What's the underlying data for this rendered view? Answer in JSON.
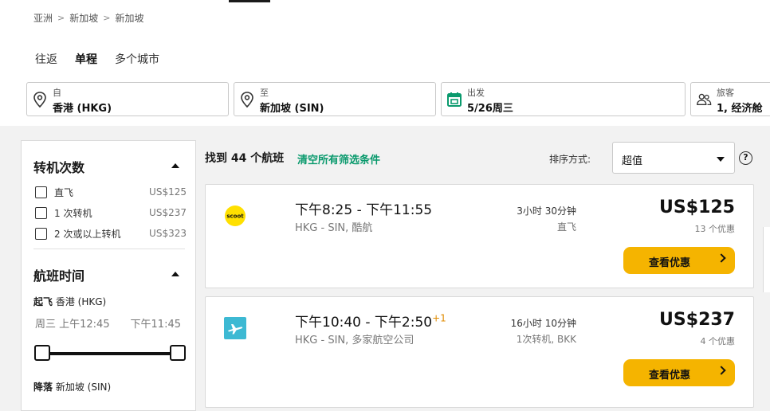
{
  "breadcrumb": [
    "亚洲",
    "新加坡",
    "新加坡"
  ],
  "trip_tabs": [
    {
      "label": "往返",
      "active": false
    },
    {
      "label": "单程",
      "active": true
    },
    {
      "label": "多个城市",
      "active": false
    }
  ],
  "search": {
    "from": {
      "label": "自",
      "value": "香港 (HKG)"
    },
    "to": {
      "label": "至",
      "value": "新加坡 (SIN)"
    },
    "depart": {
      "label": "出发",
      "value": "5/26周三"
    },
    "travelers": {
      "label": "旅客",
      "value": "1, 经济舱"
    }
  },
  "filters": {
    "stops_title": "转机次数",
    "stops": [
      {
        "label": "直飞",
        "price": "US$125"
      },
      {
        "label": "1 次转机",
        "price": "US$237"
      },
      {
        "label": "2 次或以上转机",
        "price": "US$323"
      }
    ],
    "time_title": "航班时间",
    "takeoff": {
      "label": "起飞",
      "place": "香港 (HKG)",
      "from": "周三 上午12:45",
      "to": "下午11:45"
    },
    "landing": {
      "label": "降落",
      "place": "新加坡 (SIN)"
    }
  },
  "results": {
    "count_text": "找到 44 个航班",
    "clear_text": "清空所有筛选条件",
    "sort_label": "排序方式:",
    "sort_value": "超值",
    "help_icon": "?"
  },
  "flights": [
    {
      "logo": "scoot-logo",
      "logo_text": "scoot",
      "times": "下午8:25 - 下午11:55",
      "plus_day": "",
      "route": "HKG - SIN, 酷航",
      "duration": "3小时 30分钟",
      "stops": "直飞",
      "price": "US$125",
      "deals": "13 个优惠",
      "button": "查看优惠"
    },
    {
      "logo": "multi-airline-plane-icon",
      "logo_text": "",
      "times": "下午10:40 - 下午2:50",
      "plus_day": "+1",
      "route": "HKG - SIN, 多家航空公司",
      "duration": "16小时 10分钟",
      "stops": "1次转机, BKK",
      "price": "US$237",
      "deals": "4 个优惠",
      "button": "查看优惠"
    }
  ],
  "colors": {
    "accent": "#f5b400",
    "link": "#0a9a6d",
    "calendar": "#0a9a6d",
    "scoot": "#ffe000",
    "plane_tile": "#3db9d3"
  }
}
